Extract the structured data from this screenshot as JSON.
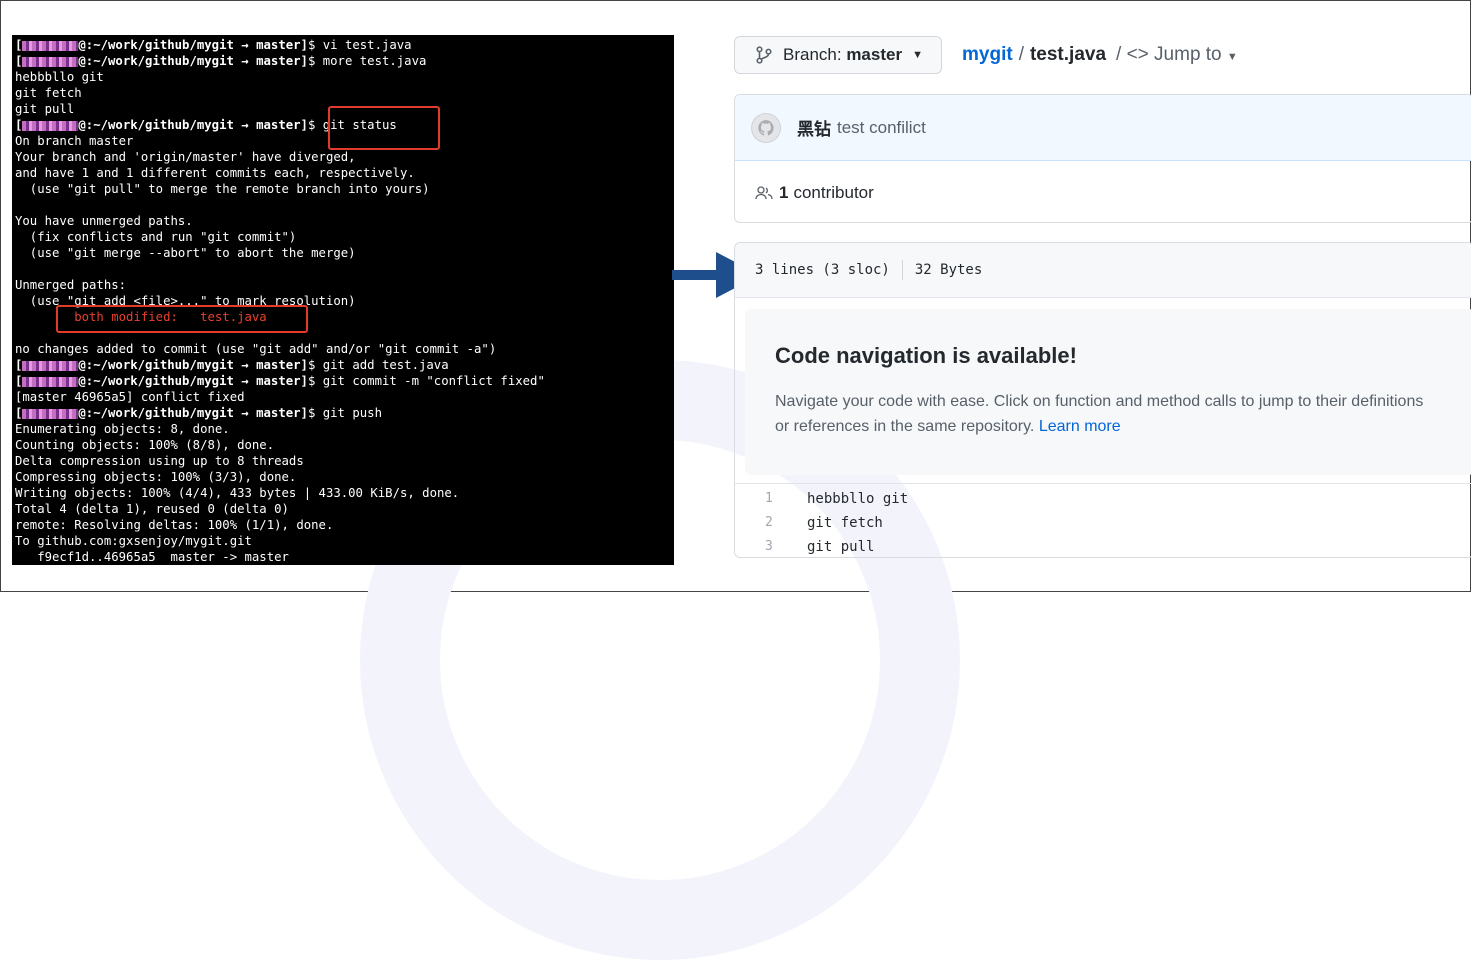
{
  "terminal": {
    "lines": [
      {
        "prompt": true,
        "masked_user": "user",
        "path": "@:~/work/github/mygit",
        "branch": "master",
        "cmd": "$ vi test.java"
      },
      {
        "prompt": true,
        "masked_user": "user",
        "path": "@:~/work/github/mygit",
        "branch": "master",
        "cmd": "$ more test.java"
      },
      {
        "text": "hebbbllo git"
      },
      {
        "text": "git fetch"
      },
      {
        "text": "git pull"
      },
      {
        "prompt": true,
        "masked_user": "user",
        "path": "@:~/work/github/mygit",
        "branch": "master",
        "cmd": "$ git status"
      },
      {
        "text": "On branch master"
      },
      {
        "text": "Your branch and 'origin/master' have diverged,"
      },
      {
        "text": "and have 1 and 1 different commits each, respectively."
      },
      {
        "text": "  (use \"git pull\" to merge the remote branch into yours)"
      },
      {
        "text": ""
      },
      {
        "text": "You have unmerged paths."
      },
      {
        "text": "  (fix conflicts and run \"git commit\")"
      },
      {
        "text": "  (use \"git merge --abort\" to abort the merge)"
      },
      {
        "text": ""
      },
      {
        "text": "Unmerged paths:"
      },
      {
        "text": "  (use \"git add <file>...\" to mark resolution)"
      },
      {
        "text": "        both modified:   test.java",
        "red": true
      },
      {
        "text": ""
      },
      {
        "text": "no changes added to commit (use \"git add\" and/or \"git commit -a\")"
      },
      {
        "prompt": true,
        "masked_user": "user",
        "path": "@:~/work/github/mygit",
        "branch": "master",
        "cmd": "$ git add test.java"
      },
      {
        "prompt": true,
        "masked_user": "user",
        "path": "@:~/work/github/mygit",
        "branch": "master",
        "cmd": "$ git commit -m \"conflict fixed\""
      },
      {
        "text": "[master 46965a5] conflict fixed"
      },
      {
        "prompt": true,
        "masked_user": "user",
        "path": "@:~/work/github/mygit",
        "branch": "master",
        "cmd": "$ git push"
      },
      {
        "text": "Enumerating objects: 8, done."
      },
      {
        "text": "Counting objects: 100% (8/8), done."
      },
      {
        "text": "Delta compression using up to 8 threads"
      },
      {
        "text": "Compressing objects: 100% (3/3), done."
      },
      {
        "text": "Writing objects: 100% (4/4), 433 bytes | 433.00 KiB/s, done."
      },
      {
        "text": "Total 4 (delta 1), reused 0 (delta 0)"
      },
      {
        "text": "remote: Resolving deltas: 100% (1/1), done."
      },
      {
        "text": "To github.com:gxsenjoy/mygit.git"
      },
      {
        "text": "   f9ecf1d..46965a5  master -> master"
      }
    ],
    "highlight_color": "#e23b2a"
  },
  "github": {
    "branch_button": {
      "prefix": "Branch: ",
      "name": "master",
      "icon": "git-branch-icon"
    },
    "breadcrumb": {
      "repo": "mygit",
      "sep": "/",
      "file": "test.java",
      "jump": "/ <> Jump to"
    },
    "commit": {
      "author": "黑钻",
      "message": "test confilict",
      "avatar_icon": "github-avatar-icon"
    },
    "contributors": {
      "count": "1",
      "label": "contributor",
      "icon": "people-icon"
    },
    "file_info": {
      "lines": "3 lines (3 sloc)",
      "size": "32 Bytes"
    },
    "code_nav": {
      "title": "Code navigation is available!",
      "description": "Navigate your code with ease. Click on function and method calls to jump to their definitions or references in the same repository.",
      "link": "Learn more"
    },
    "code_lines": [
      {
        "num": "1",
        "text": "hebbbllo git"
      },
      {
        "num": "2",
        "text": "git fetch"
      },
      {
        "num": "3",
        "text": "git pull"
      }
    ],
    "colors": {
      "link": "#0366d6",
      "text": "#24292e",
      "muted": "#586069"
    }
  },
  "arrow": {
    "color": "#1f4e8c"
  }
}
